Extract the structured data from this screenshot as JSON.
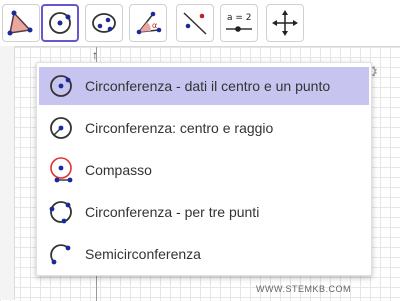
{
  "toolbar": {
    "tools": [
      {
        "icon": "polygon-icon"
      },
      {
        "icon": "circle-center-point-icon",
        "active": true
      },
      {
        "icon": "circle-through-points-icon"
      },
      {
        "icon": "angle-icon",
        "angle_label": "α"
      },
      {
        "icon": "reflect-about-line-icon"
      },
      {
        "icon": "slider-icon",
        "label": "a = 2"
      },
      {
        "icon": "move-graphics-view-icon"
      }
    ]
  },
  "graphics": {
    "y_ticks": [
      "14",
      "12",
      "10",
      "8",
      "6"
    ]
  },
  "menu": {
    "items": [
      {
        "label": "Circonferenza - dati il centro e un punto",
        "icon": "circle-center-point-icon",
        "selected": true
      },
      {
        "label": "Circonferenza: centro e raggio",
        "icon": "circle-center-radius-icon",
        "selected": false
      },
      {
        "label": "Compasso",
        "icon": "compass-icon",
        "selected": false
      },
      {
        "label": "Circonferenza - per tre punti",
        "icon": "circle-three-points-icon",
        "selected": false
      },
      {
        "label": "Semicirconferenza",
        "icon": "semicircle-icon",
        "selected": false
      }
    ]
  },
  "watermark": "WWW.STEMKB.COM",
  "colors": {
    "accent": "#6557d2",
    "selected_bg": "#c8c4f0",
    "point_blue": "#1a2a9a",
    "compass_red": "#e03030"
  }
}
